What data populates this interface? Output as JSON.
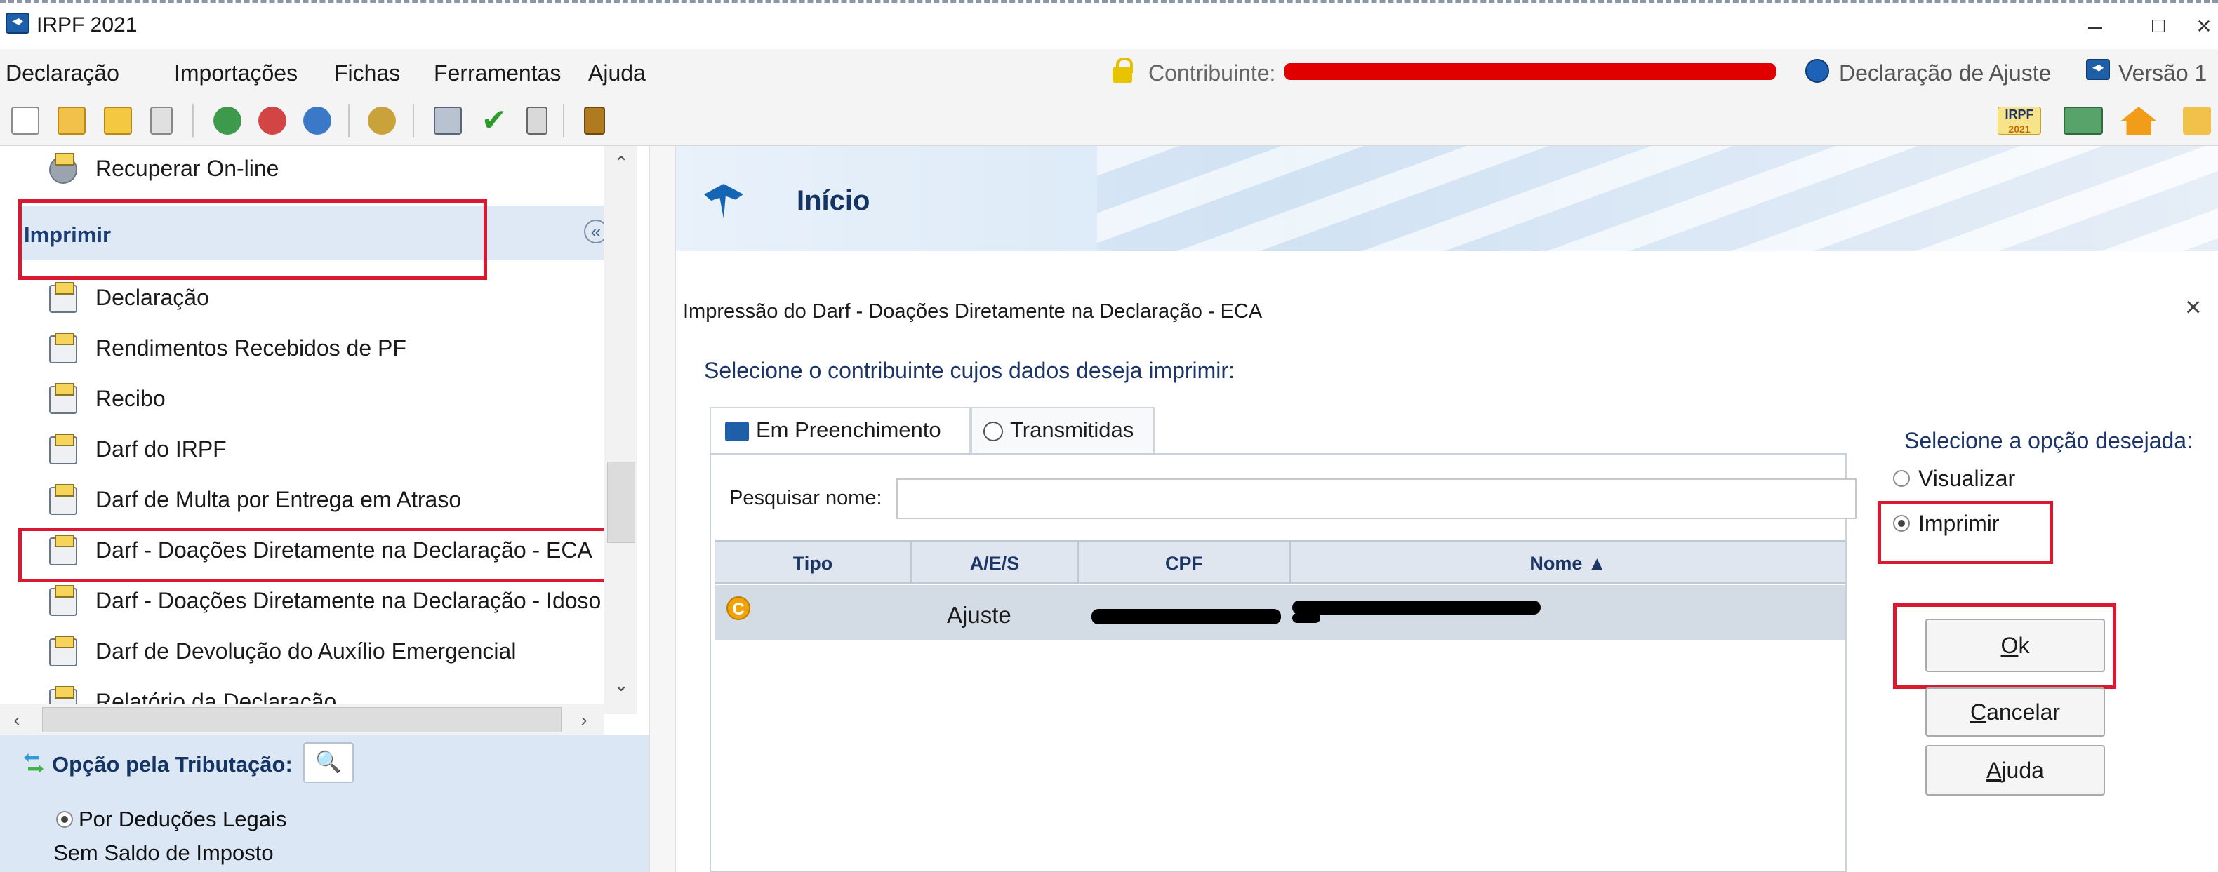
{
  "window": {
    "title": "IRPF 2021",
    "minimize": "–",
    "restore": "□",
    "close": "×"
  },
  "menubar": {
    "items": [
      "Declaração",
      "Importações",
      "Fichas",
      "Ferramentas",
      "Ajuda"
    ],
    "contribuinte_label": "Contribuinte:",
    "declaracao_type": "Declaração de Ajuste",
    "versao": "Versão 1"
  },
  "toolbar": {
    "icons": [
      "new-file-icon",
      "open-folder-icon",
      "folder-icon",
      "trash-icon",
      "import-icon",
      "transmit-icon",
      "globe-icon",
      "print-icon",
      "check-icon",
      "calculator-icon",
      "book-icon"
    ],
    "right_icons": [
      "irpf-logo-icon",
      "keyboard-icon",
      "home-icon"
    ],
    "irpf_badge": "IRPF",
    "irpf_year": "2021"
  },
  "sidebar": {
    "top_item": "Recuperar On-line",
    "group_label": "Imprimir",
    "items": [
      "Declaração",
      "Rendimentos Recebidos de PF",
      "Recibo",
      "Darf do IRPF",
      "Darf de Multa por Entrega em Atraso",
      "Darf - Doações Diretamente na Declaração - ECA",
      "Darf - Doações Diretamente na Declaração - Idoso",
      "Darf de Devolução do Auxílio Emergencial",
      "Relatório da Declaração"
    ],
    "selected_index": 5
  },
  "options_panel": {
    "label": "Opção pela Tributação:",
    "selected_option": "Por Deduções Legais",
    "status": "Sem Saldo de Imposto"
  },
  "header": {
    "title": "Início"
  },
  "dialog": {
    "title": "Impressão do Darf - Doações Diretamente na Declaração - ECA",
    "prompt": "Selecione o contribuinte cujos dados deseja imprimir:",
    "tabs": [
      "Em Preenchimento",
      "Transmitidas"
    ],
    "active_tab": 0,
    "search_label": "Pesquisar nome:",
    "search_value": "",
    "columns": [
      "Tipo",
      "A/E/S",
      "CPF",
      "Nome ▲"
    ],
    "rows": [
      {
        "tipo_badge": "C",
        "aes": "Ajuste"
      }
    ],
    "options_label": "Selecione a opção desejada:",
    "options": [
      "Visualizar",
      "Imprimir"
    ],
    "selected_option": 1,
    "buttons": {
      "ok_key": "O",
      "ok_rest": "k",
      "cancel_key": "C",
      "cancel_rest": "ancelar",
      "help_key": "A",
      "help_rest": "juda"
    }
  },
  "colors": {
    "accent": "#1c3566",
    "highlight": "#d8192f",
    "redaction_red": "#e00000",
    "selected_row": "#d3dbe4"
  }
}
